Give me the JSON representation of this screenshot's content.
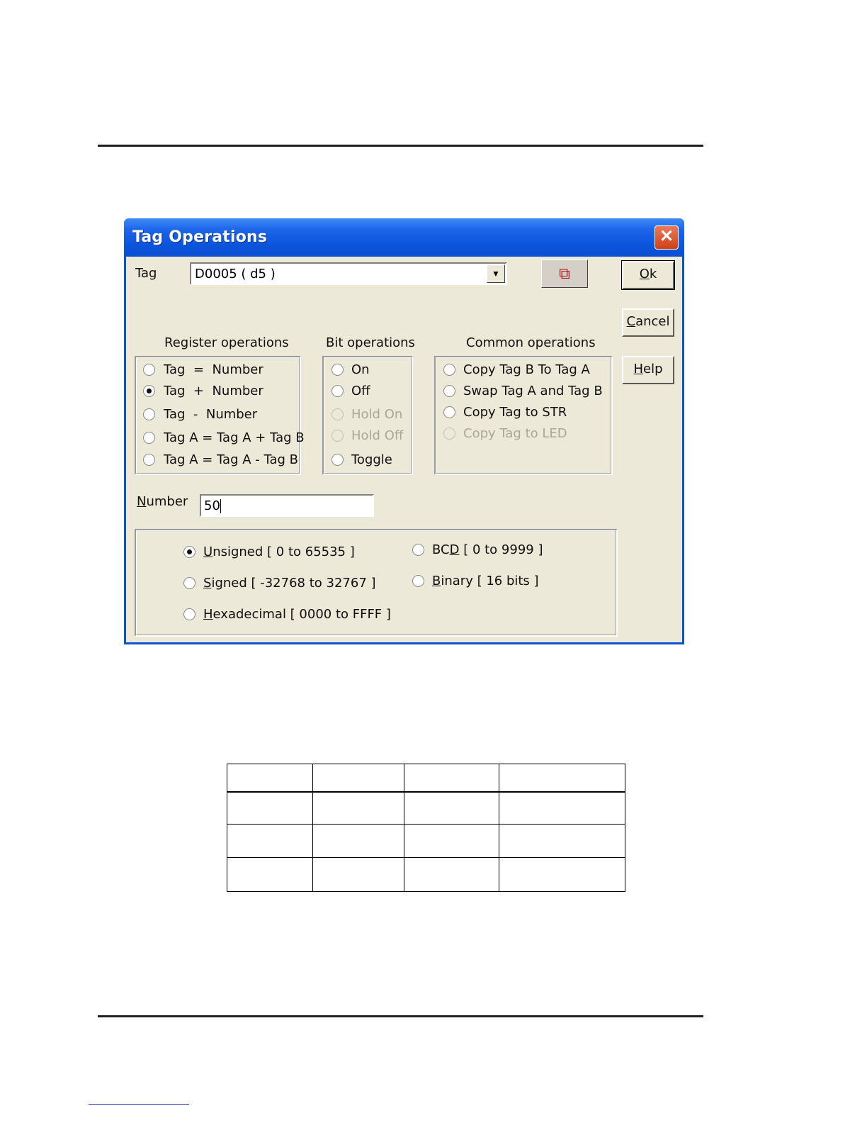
{
  "dialog": {
    "title": "Tag Operations",
    "close_label": "✕",
    "tag_label": "Tag",
    "tag_value": "D0005 ( d5 )",
    "buttons": {
      "ok": "Ok",
      "cancel": "Cancel",
      "help": "Help"
    },
    "register_operations": {
      "title": "Register operations",
      "options": [
        "Tag  =  Number",
        "Tag  +  Number",
        "Tag  -  Number",
        "Tag A = Tag A + Tag B",
        "Tag A = Tag A - Tag B"
      ],
      "selected": "Tag  +  Number"
    },
    "bit_operations": {
      "title": "Bit operations",
      "options": [
        "On",
        "Off",
        "Hold On",
        "Hold Off",
        "Toggle"
      ],
      "disabled": [
        "Hold On",
        "Hold Off"
      ]
    },
    "common_operations": {
      "title": "Common operations",
      "options": [
        "Copy Tag B To Tag A",
        "Swap Tag A and Tag B",
        "Copy Tag to STR",
        "Copy Tag to LED"
      ],
      "disabled": [
        "Copy Tag to LED"
      ]
    },
    "number_label": "Number",
    "number_value": "50",
    "format_options": {
      "unsigned": "Unsigned [ 0 to 65535 ]",
      "signed": "Signed [ -32768 to 32767 ]",
      "hexadecimal": "Hexadecimal [ 0000 to FFFF ]",
      "bcd": "BCD [ 0 to 9999 ]",
      "binary": "Binary [ 16 bits ]",
      "selected": "Unsigned [ 0 to 65535 ]"
    }
  },
  "table": {
    "rows": 4,
    "columns": 4
  }
}
